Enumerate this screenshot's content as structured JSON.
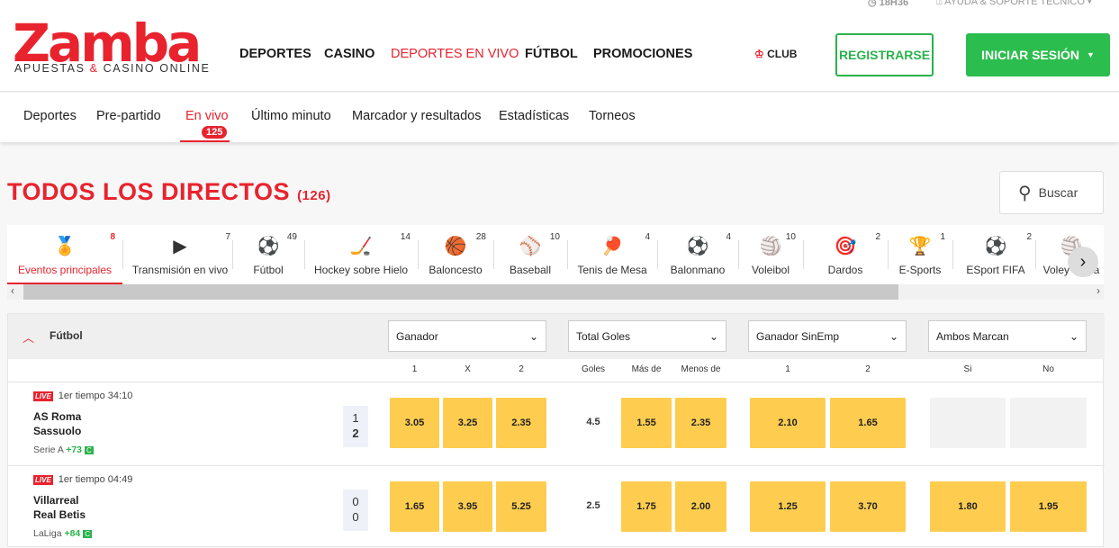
{
  "brand": {
    "name": "Zamba",
    "tagline_a": "APUESTAS",
    "tagline_amp": "&",
    "tagline_b": "CASINO ONLINE"
  },
  "top": {
    "time": "18H36",
    "help": "AYUDA & SOPORTE TÉCNICO"
  },
  "nav": [
    "DEPORTES",
    "CASINO",
    "DEPORTES EN VIVO",
    "FÚTBOL",
    "PROMOCIONES"
  ],
  "club": "CLUB",
  "register": "REGISTRARSE",
  "login": "INICIAR SESIÓN",
  "subnav": [
    "Deportes",
    "Pre-partido",
    "En vivo",
    "Último minuto",
    "Marcador y resultados",
    "Estadísticas",
    "Torneos"
  ],
  "live_count": "125",
  "page_title": "TODOS LOS DIRECTOS",
  "page_count": "(126)",
  "search": "Buscar",
  "sports": [
    {
      "label": "Eventos principales",
      "count": "8",
      "icon": "🏅"
    },
    {
      "label": "Transmisión en vivo",
      "count": "7",
      "icon": "▶"
    },
    {
      "label": "Fútbol",
      "count": "49",
      "icon": "⚽"
    },
    {
      "label": "Hockey sobre Hielo",
      "count": "14",
      "icon": "🏒"
    },
    {
      "label": "Baloncesto",
      "count": "28",
      "icon": "🏀"
    },
    {
      "label": "Baseball",
      "count": "10",
      "icon": "⚾"
    },
    {
      "label": "Tenis de Mesa",
      "count": "4",
      "icon": "🏓"
    },
    {
      "label": "Balonmano",
      "count": "4",
      "icon": "⚽"
    },
    {
      "label": "Voleibol",
      "count": "10",
      "icon": "🏐"
    },
    {
      "label": "Dardos",
      "count": "2",
      "icon": "🎯"
    },
    {
      "label": "E-Sports",
      "count": "1",
      "icon": "🏆"
    },
    {
      "label": "ESport FIFA",
      "count": "2",
      "icon": "⚽"
    },
    {
      "label": "Voley Playa",
      "count": "",
      "icon": "🏐"
    }
  ],
  "section": {
    "title": "Fútbol",
    "markets": [
      "Ganador",
      "Total Goles",
      "Ganador SinEmp",
      "Ambos Marcan"
    ],
    "cols": [
      "1",
      "X",
      "2",
      "Goles",
      "Más de",
      "Menos de",
      "1",
      "2",
      "Si",
      "No"
    ]
  },
  "matches": [
    {
      "period": "1er tiempo 34:10",
      "home": "AS Roma",
      "away": "Sassuolo",
      "league": "Serie A",
      "more": "+73",
      "score_home": "1",
      "score_away": "2",
      "odds": [
        "3.05",
        "3.25",
        "2.35",
        "4.5",
        "1.55",
        "2.35",
        "2.10",
        "1.65",
        "",
        ""
      ]
    },
    {
      "period": "1er tiempo 04:49",
      "home": "Villarreal",
      "away": "Real Betis",
      "league": "LaLiga",
      "more": "+84",
      "score_home": "0",
      "score_away": "0",
      "odds": [
        "1.65",
        "3.95",
        "5.25",
        "2.5",
        "1.75",
        "2.00",
        "1.25",
        "3.70",
        "1.80",
        "1.95"
      ]
    }
  ],
  "live_label": "LIVE",
  "colors": {
    "brand_red": "#e8232e",
    "green": "#2bbd4e",
    "odds_yellow": "#fecd50"
  }
}
